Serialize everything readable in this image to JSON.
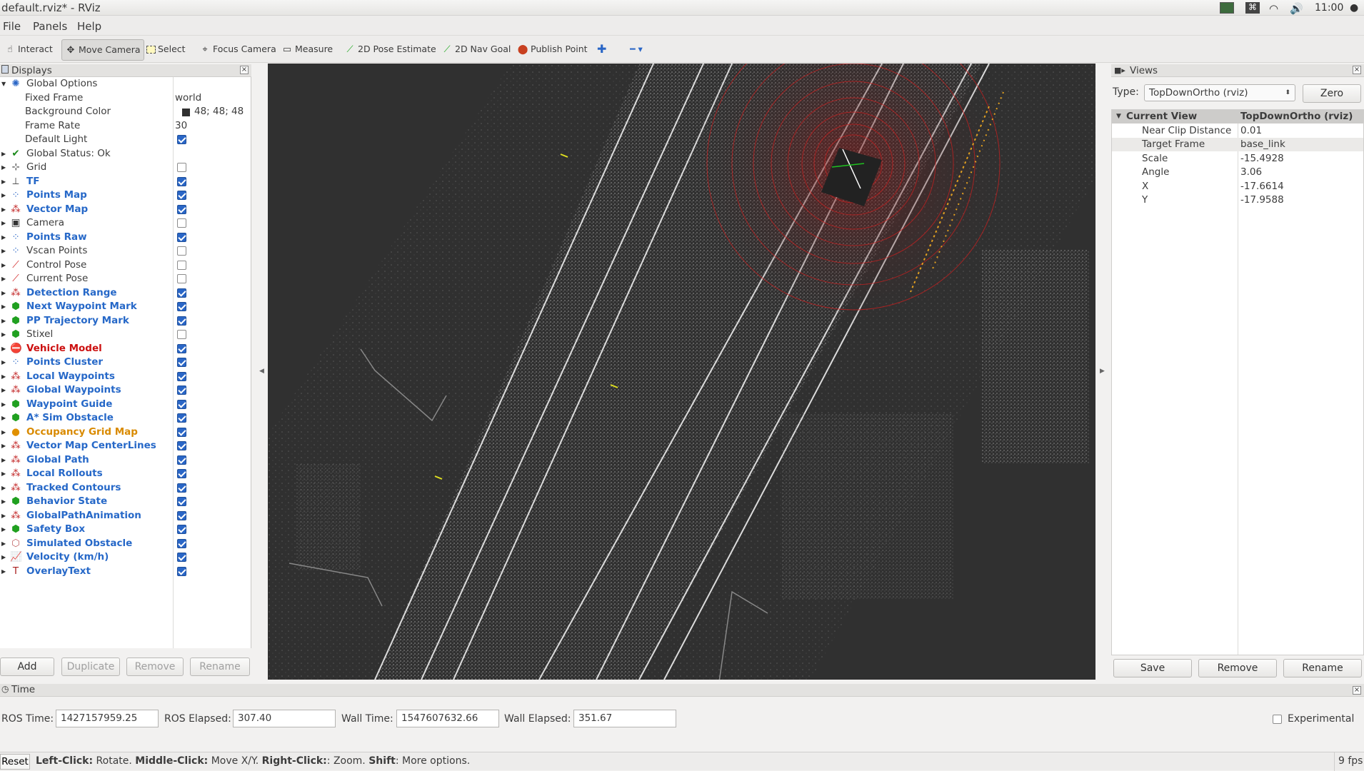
{
  "window": {
    "title": "default.rviz* - RViz",
    "clock": "11:00"
  },
  "menu": [
    "File",
    "Panels",
    "Help"
  ],
  "toolbar": {
    "interact": "Interact",
    "move_camera": "Move Camera",
    "select": "Select",
    "focus_camera": "Focus Camera",
    "measure": "Measure",
    "pose_estimate": "2D Pose Estimate",
    "nav_goal": "2D Nav Goal",
    "publish_point": "Publish Point"
  },
  "displays": {
    "title": "Displays",
    "global_options": "Global Options",
    "options": [
      {
        "label": "Fixed Frame",
        "value": "world"
      },
      {
        "label": "Background Color",
        "value": "48; 48; 48"
      },
      {
        "label": "Frame Rate",
        "value": "30"
      },
      {
        "label": "Default Light",
        "value": ""
      }
    ],
    "global_status": "Global Status: Ok",
    "items": [
      {
        "label": "Grid",
        "checked": false,
        "style": "",
        "icon": "grid-icon"
      },
      {
        "label": "TF",
        "checked": true,
        "style": "blue",
        "icon": "tf-icon"
      },
      {
        "label": "Points Map",
        "checked": true,
        "style": "blue",
        "icon": "points-icon"
      },
      {
        "label": "Vector Map",
        "checked": true,
        "style": "blue",
        "icon": "marker-array-icon"
      },
      {
        "label": "Camera",
        "checked": false,
        "style": "",
        "icon": "camera-icon"
      },
      {
        "label": "Points Raw",
        "checked": true,
        "style": "blue",
        "icon": "points-icon"
      },
      {
        "label": "Vscan Points",
        "checked": false,
        "style": "",
        "icon": "points-icon"
      },
      {
        "label": "Control Pose",
        "checked": false,
        "style": "",
        "icon": "pose-icon"
      },
      {
        "label": "Current Pose",
        "checked": false,
        "style": "",
        "icon": "pose-icon"
      },
      {
        "label": "Detection Range",
        "checked": true,
        "style": "blue",
        "icon": "marker-array-icon"
      },
      {
        "label": "Next Waypoint Mark",
        "checked": true,
        "style": "blue",
        "icon": "marker-icon"
      },
      {
        "label": "PP Trajectory Mark",
        "checked": true,
        "style": "blue",
        "icon": "marker-icon"
      },
      {
        "label": "Stixel",
        "checked": false,
        "style": "",
        "icon": "marker-icon"
      },
      {
        "label": "Vehicle Model",
        "checked": true,
        "style": "red",
        "icon": "error-icon"
      },
      {
        "label": "Points Cluster",
        "checked": true,
        "style": "blue",
        "icon": "points-icon"
      },
      {
        "label": "Local Waypoints",
        "checked": true,
        "style": "blue",
        "icon": "marker-array-icon"
      },
      {
        "label": "Global Waypoints",
        "checked": true,
        "style": "blue",
        "icon": "marker-array-icon"
      },
      {
        "label": "Waypoint Guide",
        "checked": true,
        "style": "blue",
        "icon": "marker-icon"
      },
      {
        "label": "A* Sim Obstacle",
        "checked": true,
        "style": "blue",
        "icon": "marker-icon"
      },
      {
        "label": "Occupancy Grid Map",
        "checked": true,
        "style": "orange",
        "icon": "warning-icon"
      },
      {
        "label": "Vector Map CenterLines",
        "checked": true,
        "style": "blue",
        "icon": "marker-array-icon"
      },
      {
        "label": "Global Path",
        "checked": true,
        "style": "blue",
        "icon": "marker-array-icon"
      },
      {
        "label": "Local Rollouts",
        "checked": true,
        "style": "blue",
        "icon": "marker-array-icon"
      },
      {
        "label": "Tracked Contours",
        "checked": true,
        "style": "blue",
        "icon": "marker-array-icon"
      },
      {
        "label": "Behavior State",
        "checked": true,
        "style": "blue",
        "icon": "marker-icon"
      },
      {
        "label": "GlobalPathAnimation",
        "checked": true,
        "style": "blue",
        "icon": "marker-array-icon"
      },
      {
        "label": "Safety Box",
        "checked": true,
        "style": "blue",
        "icon": "marker-icon"
      },
      {
        "label": "Simulated Obstacle",
        "checked": true,
        "style": "blue",
        "icon": "polygon-icon"
      },
      {
        "label": "Velocity (km/h)",
        "checked": true,
        "style": "blue",
        "icon": "plot-icon"
      },
      {
        "label": "OverlayText",
        "checked": true,
        "style": "blue",
        "icon": "text-icon"
      }
    ],
    "buttons": {
      "add": "Add",
      "duplicate": "Duplicate",
      "remove": "Remove",
      "rename": "Rename"
    }
  },
  "views": {
    "title": "Views",
    "type_label": "Type:",
    "type_value": "TopDownOrtho (rviz)",
    "zero": "Zero",
    "current_view_label": "Current View",
    "current_view_value": "TopDownOrtho (rviz)",
    "props": [
      {
        "k": "Near Clip Distance",
        "v": "0.01"
      },
      {
        "k": "Target Frame",
        "v": "base_link"
      },
      {
        "k": "Scale",
        "v": "-15.4928"
      },
      {
        "k": "Angle",
        "v": "3.06"
      },
      {
        "k": "X",
        "v": "-17.6614"
      },
      {
        "k": "Y",
        "v": "-17.9588"
      }
    ],
    "buttons": {
      "save": "Save",
      "remove": "Remove",
      "rename": "Rename"
    }
  },
  "time": {
    "title": "Time",
    "ros_time_label": "ROS Time:",
    "ros_time": "1427157959.25",
    "ros_elapsed_label": "ROS Elapsed:",
    "ros_elapsed": "307.40",
    "wall_time_label": "Wall Time:",
    "wall_time": "1547607632.66",
    "wall_elapsed_label": "Wall Elapsed:",
    "wall_elapsed": "351.67",
    "experimental": "Experimental"
  },
  "status": {
    "reset": "Reset",
    "hint_left": "Left-Click:",
    "hint_left_t": " Rotate. ",
    "hint_mid": "Middle-Click:",
    "hint_mid_t": " Move X/Y. ",
    "hint_right": "Right-Click:",
    "hint_right_t": ": Zoom. ",
    "hint_shift": "Shift",
    "hint_shift_t": ": More options.",
    "fps": "9 fps"
  }
}
